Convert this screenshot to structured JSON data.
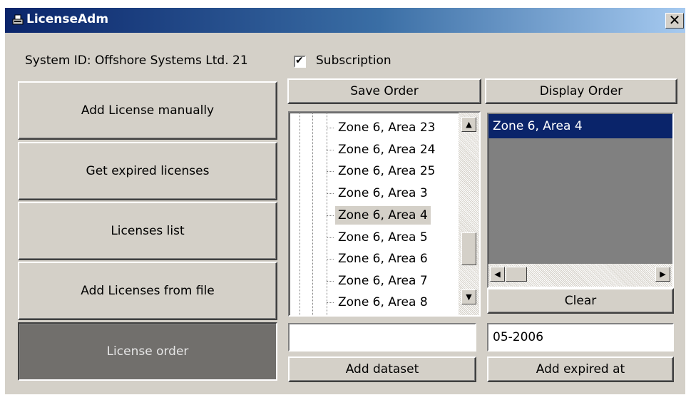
{
  "window": {
    "title": "LicenseAdm",
    "close_glyph": "✕"
  },
  "header": {
    "system_id": "System ID: Offshore Systems Ltd. 21",
    "subscription_label": "Subscription",
    "subscription_checked": true
  },
  "sidebar": {
    "buttons": [
      {
        "label": "Add License manually"
      },
      {
        "label": "Get expired licenses"
      },
      {
        "label": "Licenses list"
      },
      {
        "label": "Add Licenses from file"
      },
      {
        "label": "License order",
        "active": true
      }
    ]
  },
  "order": {
    "save_label": "Save Order",
    "display_label": "Display Order",
    "tree_items": [
      "Zone 6, Area 23",
      "Zone 6, Area 24",
      "Zone 6, Area 25",
      "Zone 6, Area 3",
      "Zone 6, Area 4",
      "Zone 6, Area 5",
      "Zone 6, Area 6",
      "Zone 6, Area 7",
      "Zone 6, Area 8"
    ],
    "tree_selected": "Zone 6, Area 4",
    "selected_items": [
      "Zone 6, Area 4"
    ],
    "clear_label": "Clear",
    "dataset_value": "",
    "add_dataset_label": "Add dataset",
    "expired_value": "05-2006",
    "add_expired_label": "Add expired at"
  },
  "icons": {
    "title_icon": "app-icon",
    "scroll_up": "▲",
    "scroll_down": "▼",
    "scroll_left": "◀",
    "scroll_right": "▶",
    "check": "✔"
  },
  "colors": {
    "title_bar_start": "#0a246a",
    "title_bar_end": "#a6caf0",
    "face": "#d4d0c8",
    "selection": "#0a246a",
    "active_button": "#716f6c"
  }
}
